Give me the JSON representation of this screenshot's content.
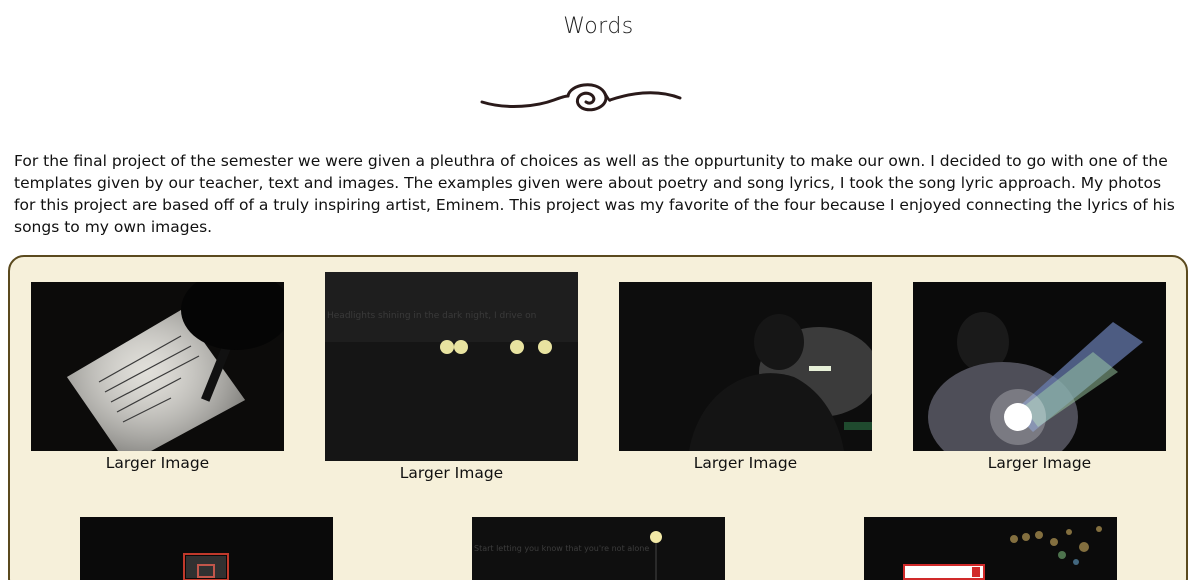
{
  "page": {
    "title": "Words",
    "intro": "For the final project of the semester we were given a pleuthra of choices as well as the oppurtunity to make our own. I decided to go with one of the templates given by our teacher, text and images. The examples given were about poetry and song lyrics, I took the song lyric approach. My photos for this project are based off of a truly inspiring artist, Eminem. This project was my favorite of the four because I enjoyed connecting the lyrics of his songs to my own images."
  },
  "gallery": {
    "items": [
      {
        "caption": "Larger Image",
        "icon": "notebook-pen-photo"
      },
      {
        "caption": "Larger Image",
        "icon": "night-headlights-photo",
        "overlay": "Headlights shining in the dark night, I drive on"
      },
      {
        "caption": "Larger Image",
        "icon": "man-by-lamp-photo"
      },
      {
        "caption": "Larger Image",
        "icon": "man-with-light-flare-photo"
      },
      {
        "caption": "",
        "icon": "basketball-hoop-photo"
      },
      {
        "caption": "",
        "icon": "streetlight-photo",
        "overlay": "Start letting you know that you're not alone"
      },
      {
        "caption": "",
        "icon": "phone-bokeh-photo"
      }
    ]
  },
  "colors": {
    "gallery_bg": "#f6f0da",
    "gallery_border": "#5b4a1e"
  }
}
